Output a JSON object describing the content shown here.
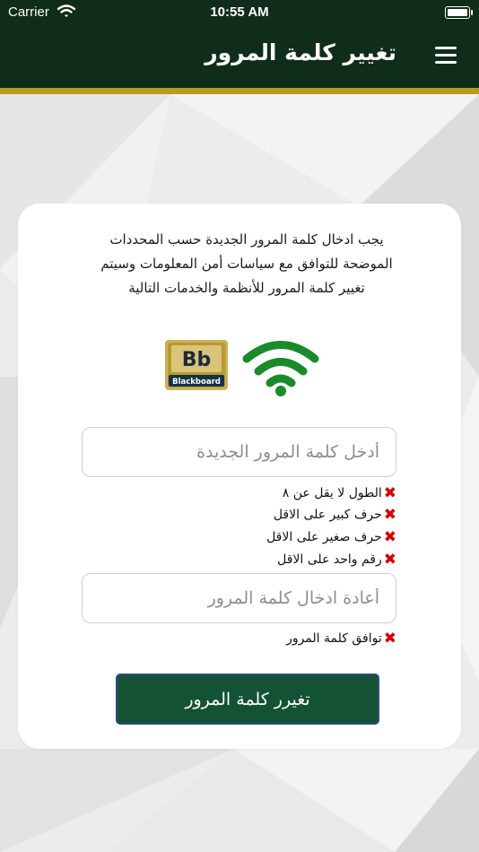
{
  "status_bar": {
    "carrier": "Carrier",
    "time": "10:55 AM"
  },
  "nav": {
    "title": "تغيير كلمة المرور",
    "menu_icon": "hamburger-menu-icon"
  },
  "intro_text": "يجب ادخال كلمة المرور الجديدة حسب المحددات الموضحة للتوافق مع سياسات أمن المعلومات وسيتم تغيير كلمة المرور للأنظمة والخدمات التالية",
  "services": [
    {
      "name": "Blackboard",
      "logo_text": "Bb",
      "icon": "blackboard-logo-icon"
    },
    {
      "icon": "wifi-icon",
      "color": "#1a8a2a"
    }
  ],
  "new_password": {
    "placeholder": "أدخل كلمة المرور الجديدة",
    "value": ""
  },
  "rules": [
    {
      "text": "الطول لا يقل عن ٨",
      "status": "fail"
    },
    {
      "text": "حرف كبير على الاقل",
      "status": "fail"
    },
    {
      "text": "حرف صغير على الاقل",
      "status": "fail"
    },
    {
      "text": "رقم واحد على الاقل",
      "status": "fail"
    }
  ],
  "confirm_password": {
    "placeholder": "أعادة ادخال كلمة المرور",
    "value": ""
  },
  "match_rule": {
    "text": "توافق كلمة المرور",
    "status": "fail"
  },
  "submit_label": "تغيرر كلمة المرور",
  "colors": {
    "header": "#0f2d1a",
    "gold": "#b99a1e",
    "button": "#145236",
    "fail": "#d40000"
  }
}
